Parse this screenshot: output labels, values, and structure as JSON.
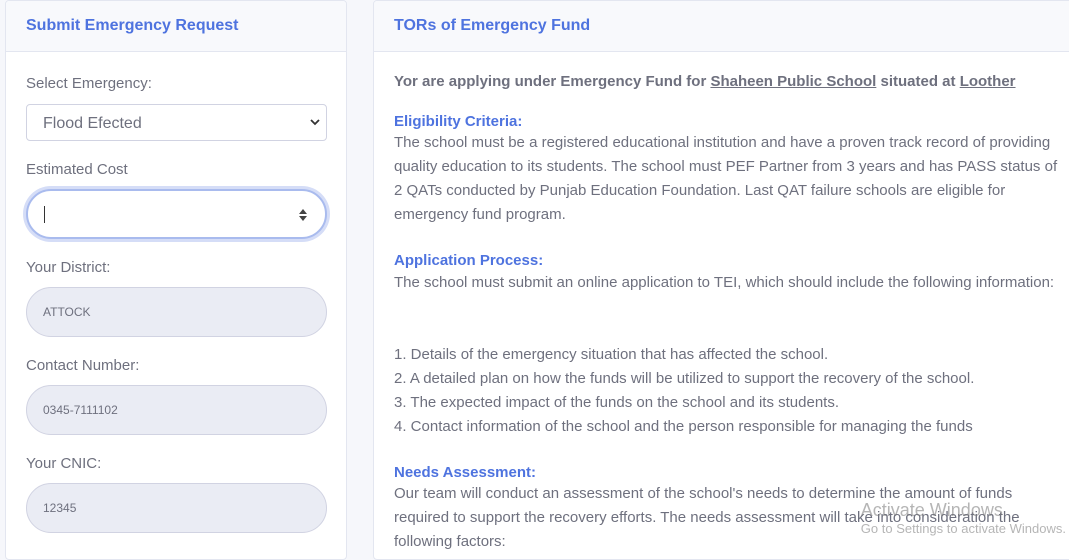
{
  "left_card": {
    "title": "Submit Emergency Request",
    "emergency": {
      "label": "Select Emergency:",
      "value": "Flood Efected"
    },
    "cost": {
      "label": "Estimated Cost",
      "value": ""
    },
    "district": {
      "label": "Your District:",
      "value": "ATTOCK"
    },
    "contact": {
      "label": "Contact Number:",
      "value": "0345-7111102"
    },
    "cnic": {
      "label": "Your CNIC:",
      "value": "12345"
    }
  },
  "right_card": {
    "title": "TORs of Emergency Fund",
    "intro_prefix": "Yor are applying under Emergency Fund for",
    "school_name": "Shaheen Public School",
    "intro_mid": "situated at",
    "location": "Loother",
    "eligibility": {
      "heading": "Eligibility Criteria:",
      "text": "The school must be a registered educational institution and have a proven track record of providing quality education to its students. The school must PEF Partner from 3 years and has PASS status of 2 QATs conducted by Punjab Education Foundation. Last QAT failure schools are eligible for emergency fund program."
    },
    "application": {
      "heading": "Application Process:",
      "text": "The school must submit an online application to TEI, which should include the following information:",
      "items": [
        "1. Details of the emergency situation that has affected the school.",
        "2. A detailed plan on how the funds will be utilized to support the recovery of the school.",
        "3. The expected impact of the funds on the school and its students.",
        "4. Contact information of the school and the person responsible for managing the funds"
      ]
    },
    "needs": {
      "heading": "Needs Assessment:",
      "text": "Our team will conduct an assessment of the school's needs to determine the amount of funds required to support the recovery efforts. The needs assessment will take into consideration the following factors:"
    }
  },
  "watermark": {
    "line1": "Activate Windows",
    "line2": "Go to Settings to activate Windows."
  },
  "colors": {
    "accent": "#4e73df",
    "text": "#6e707e",
    "field_bg": "#eaecf4"
  }
}
